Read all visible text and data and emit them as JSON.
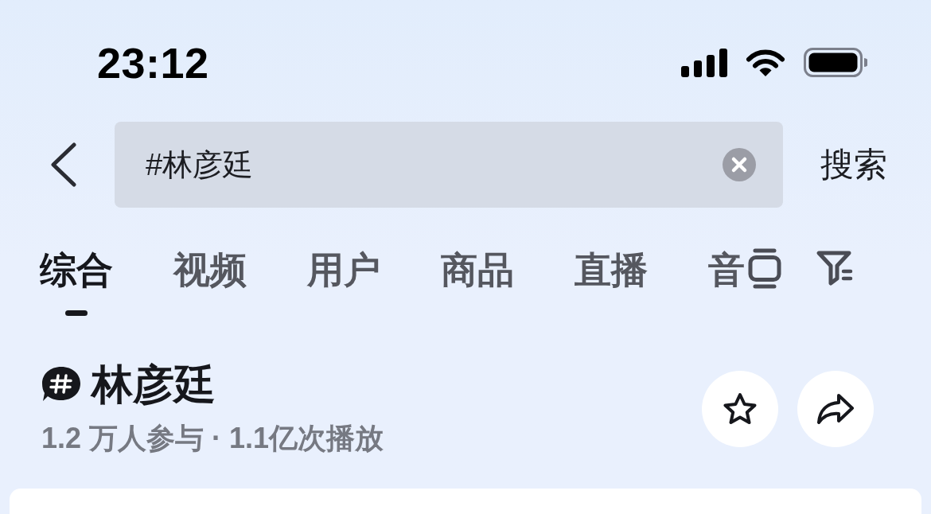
{
  "status_bar": {
    "time": "23:12"
  },
  "search": {
    "value": "#林彦廷",
    "submit": "搜索"
  },
  "tabs": [
    {
      "label": "综合",
      "selected": true
    },
    {
      "label": "视频",
      "selected": false
    },
    {
      "label": "用户",
      "selected": false
    },
    {
      "label": "商品",
      "selected": false
    },
    {
      "label": "直播",
      "selected": false
    },
    {
      "label": "音",
      "selected": false
    }
  ],
  "topic": {
    "title": "林彦廷",
    "stats": "1.2 万人参与 · 1.1亿次播放"
  }
}
